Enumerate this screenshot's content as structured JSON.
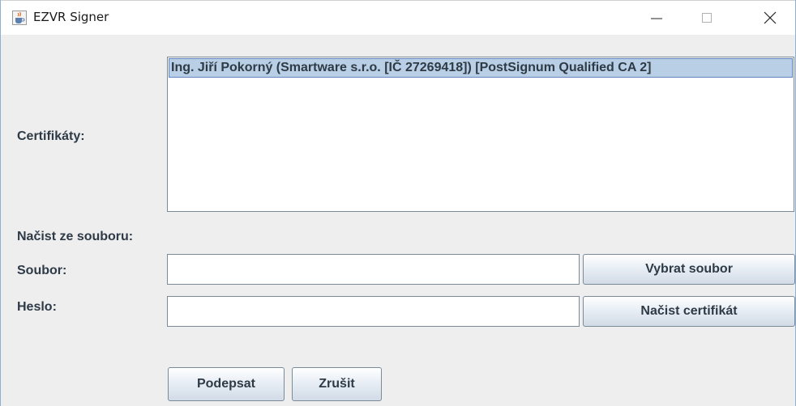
{
  "window": {
    "title": "EZVR Signer",
    "icons": {
      "app": "java-coffee-icon",
      "minimize": "minimize-icon",
      "maximize": "maximize-icon",
      "close": "close-icon"
    }
  },
  "form": {
    "certificates_label": "Certifikáty:",
    "certificates": [
      "Ing. Jiří Pokorný (Smartware s.r.o. [IČ 27269418]) [PostSignum Qualified CA 2]"
    ],
    "load_from_file_label": "Načist ze souboru:",
    "file_label": "Soubor:",
    "file_value": "",
    "choose_file_button": "Vybrat soubor",
    "password_label": "Heslo:",
    "password_value": "",
    "load_certificate_button": "Načist certifikát",
    "sign_button": "Podepsat",
    "cancel_button": "Zrušit"
  },
  "colors": {
    "window_background": "#eeeeee",
    "selection_background": "#b8cfe5",
    "selection_border": "#6382bf",
    "label_text": "#2e3a46"
  }
}
